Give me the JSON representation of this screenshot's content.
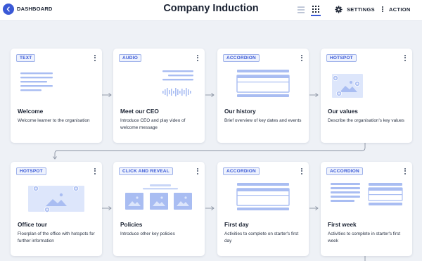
{
  "header": {
    "back_label": "DASHBOARD",
    "title": "Company Induction",
    "settings_label": "SETTINGS",
    "action_label": "ACTION",
    "active_view": "grid"
  },
  "colors": {
    "accent": "#3a59d6",
    "illustration": "#a9bdf2",
    "illustration_light": "#c9d6f7",
    "connector": "#8a93a3"
  },
  "cards": [
    {
      "type": "TEXT",
      "title": "Welcome",
      "description": "Welcome learner to the organisation"
    },
    {
      "type": "AUDIO",
      "title": "Meet our CEO",
      "description": "Introduce CEO and play video of welcome message"
    },
    {
      "type": "ACCORDION",
      "title": "Our history",
      "description": "Brief overview of key dates and events"
    },
    {
      "type": "HOTSPOT",
      "title": "Our values",
      "description": "Describe the organisation's key values"
    },
    {
      "type": "HOTSPOT",
      "title": "Office tour",
      "description": "Floorplan of the office with hotspots for further information"
    },
    {
      "type": "CLICK AND REVEAL",
      "title": "Policies",
      "description": "Introduce other key policies"
    },
    {
      "type": "ACCORDION",
      "title": "First day",
      "description": "Activities to complete on starter's first day"
    },
    {
      "type": "ACCORDION",
      "title": "First week",
      "description": "Activities to complete in starter's first week"
    }
  ]
}
